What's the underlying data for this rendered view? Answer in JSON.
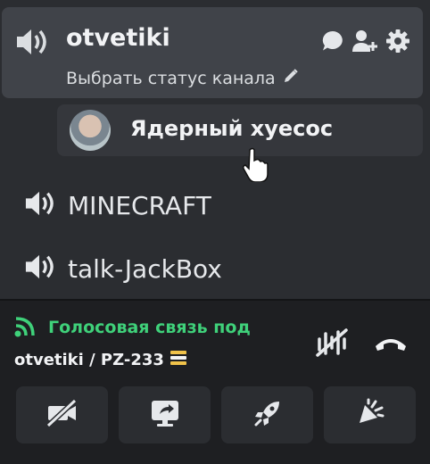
{
  "channel": {
    "name": "otvetiki",
    "status_label": "Выбрать статус канала",
    "icons": [
      "speaker-icon",
      "chat-bubble-icon",
      "add-member-icon",
      "settings-gear-icon",
      "pencil-icon"
    ]
  },
  "member": {
    "name": "Ядерный хуесос"
  },
  "channels": [
    {
      "name": "MINECRAFT",
      "icon": "speaker-icon"
    },
    {
      "name": "talk-JackBox",
      "icon": "speaker-icon"
    }
  ],
  "voice": {
    "status": "Голосовая связь под",
    "location": "otvetiki / PZ-233",
    "colors": {
      "connected": "#3fd17a"
    }
  },
  "buttons": [
    {
      "name": "camera-off",
      "icon": "video-off-icon"
    },
    {
      "name": "screen-share",
      "icon": "screen-share-icon"
    },
    {
      "name": "activity",
      "icon": "rocket-icon"
    },
    {
      "name": "soundboard",
      "icon": "soundboard-icon"
    }
  ]
}
